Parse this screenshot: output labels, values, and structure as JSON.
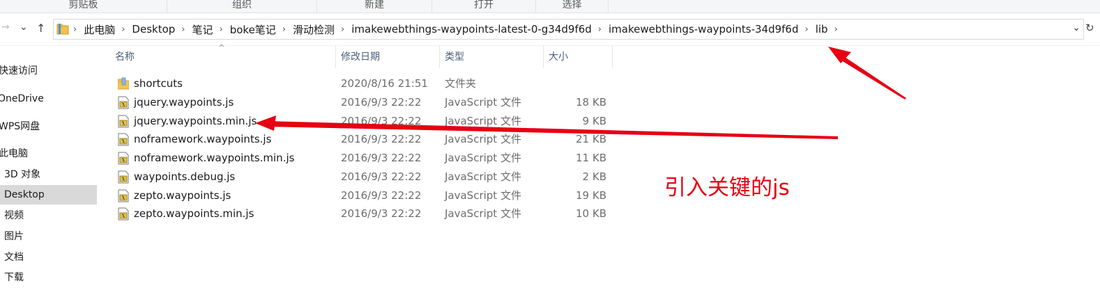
{
  "ribbon": {
    "groups": [
      "剪贴板",
      "组织",
      "新建",
      "打开",
      "选择"
    ]
  },
  "nav_buttons": {
    "back": "←",
    "forward": "→",
    "recent": "⌄",
    "up": "↑",
    "refresh": "↻"
  },
  "address": {
    "crumbs": [
      "此电脑",
      "Desktop",
      "笔记",
      "boke笔记",
      "滑动检测",
      "imakewebthings-waypoints-latest-0-g34d9f6d",
      "imakewebthings-waypoints-34d9f6d",
      "lib"
    ],
    "separator": "›",
    "dropdown": "⌄"
  },
  "sidebar": {
    "items": [
      {
        "label": "快速访问",
        "selected": false
      },
      {
        "label": "OneDrive",
        "selected": false
      },
      {
        "label": "WPS网盘",
        "selected": false
      },
      {
        "label": "此电脑",
        "selected": false
      },
      {
        "label": "3D 对象",
        "selected": false
      },
      {
        "label": "Desktop",
        "selected": true
      },
      {
        "label": "视频",
        "selected": false
      },
      {
        "label": "图片",
        "selected": false
      },
      {
        "label": "文档",
        "selected": false
      },
      {
        "label": "下载",
        "selected": false
      }
    ]
  },
  "columns": {
    "name": "名称",
    "modified": "修改日期",
    "type": "类型",
    "size": "大小",
    "sort_indicator": "^"
  },
  "files": [
    {
      "name": "shortcuts",
      "modified": "2020/8/16 21:51",
      "type": "文件夹",
      "size": "",
      "icon": "folder-icon"
    },
    {
      "name": "jquery.waypoints.js",
      "modified": "2016/9/3 22:22",
      "type": "JavaScript 文件",
      "size": "18 KB",
      "icon": "js-file-icon"
    },
    {
      "name": "jquery.waypoints.min.js",
      "modified": "2016/9/3 22:22",
      "type": "JavaScript 文件",
      "size": "9 KB",
      "icon": "js-file-icon"
    },
    {
      "name": "noframework.waypoints.js",
      "modified": "2016/9/3 22:22",
      "type": "JavaScript 文件",
      "size": "21 KB",
      "icon": "js-file-icon"
    },
    {
      "name": "noframework.waypoints.min.js",
      "modified": "2016/9/3 22:22",
      "type": "JavaScript 文件",
      "size": "11 KB",
      "icon": "js-file-icon"
    },
    {
      "name": "waypoints.debug.js",
      "modified": "2016/9/3 22:22",
      "type": "JavaScript 文件",
      "size": "2 KB",
      "icon": "js-file-icon"
    },
    {
      "name": "zepto.waypoints.js",
      "modified": "2016/9/3 22:22",
      "type": "JavaScript 文件",
      "size": "19 KB",
      "icon": "js-file-icon"
    },
    {
      "name": "zepto.waypoints.min.js",
      "modified": "2016/9/3 22:22",
      "type": "JavaScript 文件",
      "size": "10 KB",
      "icon": "js-file-icon"
    }
  ],
  "annotation": {
    "text": "引入关键的js",
    "color": "#e60012"
  }
}
